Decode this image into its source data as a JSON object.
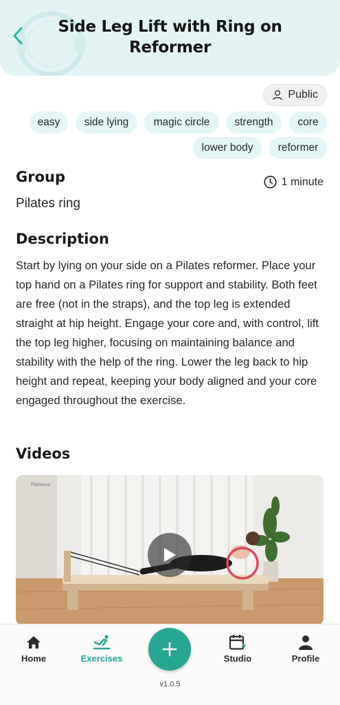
{
  "header": {
    "title": "Side Leg Lift with Ring on Reformer",
    "back_icon": "chevron-left-icon",
    "accent": "#2fb3a6",
    "background": "#e3f3f4"
  },
  "visibility": {
    "label": "Public",
    "icon": "user-icon"
  },
  "tags": [
    "easy",
    "side lying",
    "magic circle",
    "strength",
    "core",
    "lower body",
    "reformer"
  ],
  "group": {
    "heading": "Group",
    "value": "Pilates ring"
  },
  "duration": {
    "label": "1 minute",
    "icon": "clock-icon"
  },
  "description": {
    "heading": "Description",
    "text": "Start by lying on your side on a Pilates reformer. Place your top hand on a Pilates ring for support and stability. Both feet are free (not in the straps), and the top leg is extended straight at hip height. Engage your core and, with control, lift the top leg higher, focusing on maintaining balance and stability with the help of the ring. Lower the leg back to hip height and repeat, keeping your body aligned and your core engaged throughout the exercise."
  },
  "videos": {
    "heading": "Videos",
    "watermark": "Planoura",
    "play_icon": "play-icon"
  },
  "nav": {
    "items": [
      {
        "label": "Home",
        "icon": "home-icon"
      },
      {
        "label": "Exercises",
        "icon": "exercise-icon",
        "active": true
      },
      {
        "label": "Studio",
        "icon": "calendar-icon"
      },
      {
        "label": "Profile",
        "icon": "user-icon"
      }
    ],
    "add_icon": "plus-icon",
    "active_color": "#24a594"
  },
  "version": "v1.0.5"
}
